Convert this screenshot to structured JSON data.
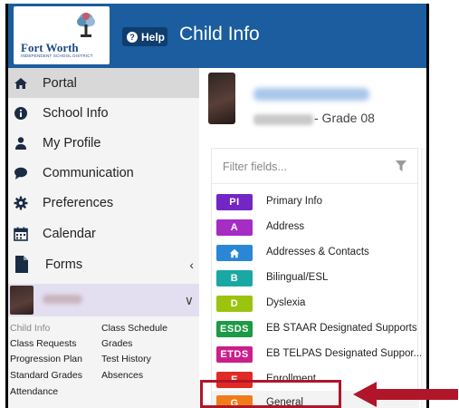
{
  "header": {
    "logo_text": "Fort Worth",
    "logo_subtext": "INDEPENDENT SCHOOL DISTRICT",
    "help_label": "Help",
    "page_title": "Child Info"
  },
  "sidebar": {
    "items": [
      {
        "label": "Portal",
        "icon": "home-icon"
      },
      {
        "label": "School Info",
        "icon": "info-icon"
      },
      {
        "label": "My Profile",
        "icon": "user-icon"
      },
      {
        "label": "Communication",
        "icon": "chat-icon"
      },
      {
        "label": "Preferences",
        "icon": "gear-icon"
      },
      {
        "label": "Calendar",
        "icon": "calendar-icon"
      },
      {
        "label": "Forms",
        "icon": "file-icon"
      }
    ],
    "sub_links": {
      "child_info": "Child Info",
      "class_schedule": "Class Schedule",
      "class_requests": "Class Requests",
      "grades": "Grades",
      "progression_plan": "Progression Plan",
      "test_history": "Test History",
      "standard_grades": "Standard Grades",
      "absences": "Absences",
      "attendance": "Attendance"
    }
  },
  "main": {
    "grade_text": "- Grade 08",
    "filter_placeholder": "Filter fields...",
    "fields": [
      {
        "badge": "PI",
        "label": "Primary Info",
        "color": "#7226c4"
      },
      {
        "badge": "A",
        "label": "Address",
        "color": "#a52cc4"
      },
      {
        "badge": "home-icon",
        "label": "Addresses & Contacts",
        "color": "#2a87d6"
      },
      {
        "badge": "B",
        "label": "Bilingual/ESL",
        "color": "#1aa8a5"
      },
      {
        "badge": "D",
        "label": "Dyslexia",
        "color": "#9bc40f"
      },
      {
        "badge": "ESDS",
        "label": "EB STAAR Designated Supports",
        "color": "#1c9a45"
      },
      {
        "badge": "ETDS",
        "label": "EB TELPAS Designated Suppor...",
        "color": "#cc1e8a"
      },
      {
        "badge": "E",
        "label": "Enrollment",
        "color": "#e02a24"
      },
      {
        "badge": "G",
        "label": "General",
        "color": "#f07b1a"
      }
    ]
  },
  "colors": {
    "header_blue": "#1b5d9e",
    "highlight_red": "#b0152a"
  }
}
